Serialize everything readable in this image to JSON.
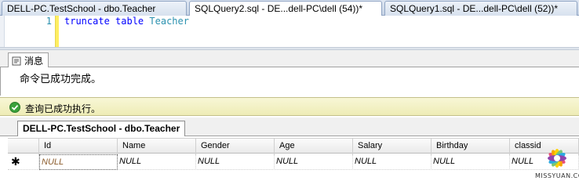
{
  "tabs": [
    {
      "label": "DELL-PC.TestSchool - dbo.Teacher",
      "active": false
    },
    {
      "label": "SQLQuery2.sql - DE...dell-PC\\dell (54))*",
      "active": true
    },
    {
      "label": "SQLQuery1.sql - DE...dell-PC\\dell (52))*",
      "active": false
    }
  ],
  "editor": {
    "line_number": "1",
    "code": {
      "kw1": "truncate",
      "kw2": "table",
      "ident": "Teacher"
    }
  },
  "messages": {
    "tab_label": "消息",
    "text": "命令已成功完成。"
  },
  "status": {
    "text": "查询已成功执行。"
  },
  "table_tab": {
    "label": "DELL-PC.TestSchool - dbo.Teacher"
  },
  "grid": {
    "columns": [
      "Id",
      "Name",
      "Gender",
      "Age",
      "Salary",
      "Birthday",
      "classid"
    ],
    "new_row_marker": "✱",
    "row": [
      "NULL",
      "NULL",
      "NULL",
      "NULL",
      "NULL",
      "NULL",
      "NULL"
    ]
  },
  "watermark": {
    "text": "MISSYUAN.COM"
  },
  "colors": {
    "keyword": "#0000ff",
    "identifier": "#2b91af",
    "status_bg": "#f8f7d6",
    "success_icon": "#3aa23a"
  }
}
